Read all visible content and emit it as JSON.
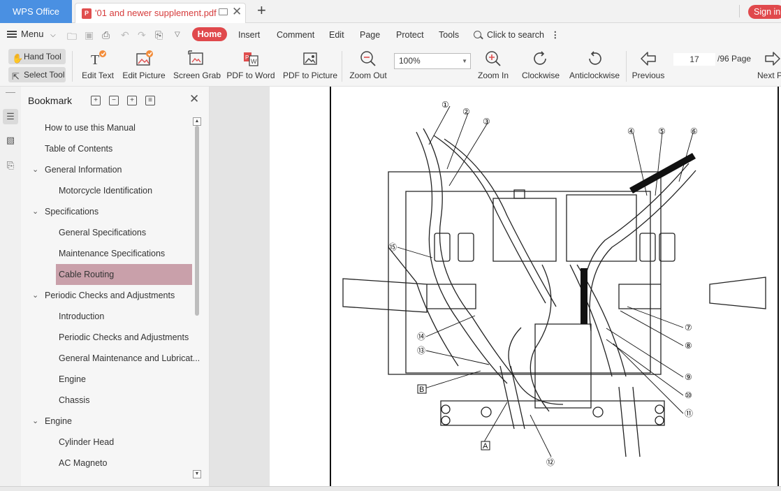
{
  "app": {
    "name": "WPS Office"
  },
  "tab": {
    "title": "'01 and newer supplement.pdf"
  },
  "account": {
    "signin": "Sign in"
  },
  "menu": {
    "menu_label": "Menu",
    "items": [
      "Home",
      "Insert",
      "Comment",
      "Edit",
      "Page",
      "Protect",
      "Tools"
    ],
    "search": "Click to search"
  },
  "toolbar": {
    "hand_tool": "Hand Tool",
    "select_tool": "Select Tool",
    "edit_text": "Edit Text",
    "edit_picture": "Edit Picture",
    "screen_grab": "Screen Grab",
    "pdf_to_word": "PDF to Word",
    "pdf_to_picture": "PDF to Picture",
    "zoom_out": "Zoom Out",
    "zoom_value": "100%",
    "zoom_in": "Zoom In",
    "clockwise": "Clockwise",
    "anticlockwise": "Anticlockwise",
    "previous": "Previous",
    "current_page": "17",
    "total_pages": "/96 Page",
    "next": "Next Pa"
  },
  "bookmark": {
    "title": "Bookmark",
    "items": [
      {
        "label": "How to use this Manual",
        "level": 1,
        "expandable": false
      },
      {
        "label": "Table of Contents",
        "level": 1,
        "expandable": false
      },
      {
        "label": "General Information",
        "level": 1,
        "expandable": true
      },
      {
        "label": "Motorcycle Identification",
        "level": 2,
        "expandable": false
      },
      {
        "label": "Specifications",
        "level": 1,
        "expandable": true
      },
      {
        "label": "General Specifications",
        "level": 2,
        "expandable": false
      },
      {
        "label": "Maintenance Specifications",
        "level": 2,
        "expandable": false
      },
      {
        "label": "Cable Routing",
        "level": 2,
        "expandable": false,
        "selected": true
      },
      {
        "label": "Periodic Checks and Adjustments",
        "level": 1,
        "expandable": true
      },
      {
        "label": "Introduction",
        "level": 2,
        "expandable": false
      },
      {
        "label": "Periodic Checks and Adjustments",
        "level": 2,
        "expandable": false
      },
      {
        "label": "General Maintenance and Lubricat...",
        "level": 2,
        "expandable": false
      },
      {
        "label": "Engine",
        "level": 2,
        "expandable": false
      },
      {
        "label": "Chassis",
        "level": 2,
        "expandable": false
      },
      {
        "label": "Engine",
        "level": 1,
        "expandable": true
      },
      {
        "label": "Cylinder Head",
        "level": 2,
        "expandable": false
      },
      {
        "label": "AC Magneto",
        "level": 2,
        "expandable": false
      }
    ]
  },
  "diagram": {
    "callouts": [
      "①",
      "②",
      "③",
      "④",
      "⑤",
      "⑥",
      "⑦",
      "⑧",
      "⑨",
      "⑩",
      "⑪",
      "⑫",
      "⑬",
      "⑭",
      "⑮"
    ],
    "boxes": [
      "A",
      "B"
    ]
  }
}
